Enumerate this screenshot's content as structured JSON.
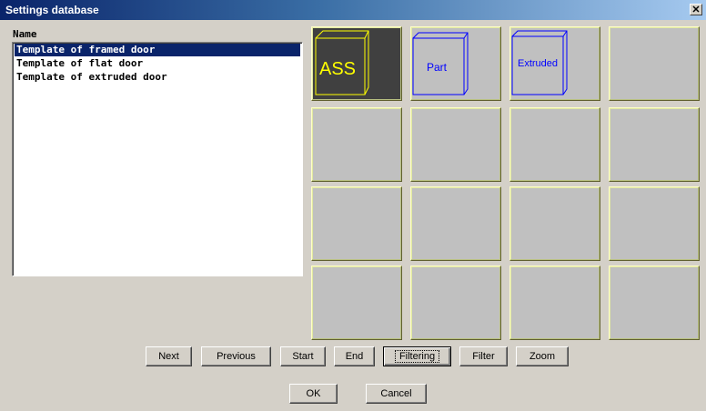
{
  "window": {
    "title": "Settings database",
    "close_glyph": "✕"
  },
  "list": {
    "header": "Name",
    "items": [
      {
        "label": "Template of framed door",
        "selected": true
      },
      {
        "label": "Template of flat door",
        "selected": false
      },
      {
        "label": "Template of extruded door",
        "selected": false
      }
    ]
  },
  "tiles": {
    "labels": [
      "ASS",
      "Part",
      "Extruded"
    ]
  },
  "nav_buttons": {
    "next": "Next",
    "previous": "Previous",
    "start": "Start",
    "end": "End",
    "filtering": "Filtering",
    "filter": "Filter",
    "zoom": "Zoom"
  },
  "dialog_buttons": {
    "ok": "OK",
    "cancel": "Cancel"
  },
  "colors": {
    "titlebar_start": "#0a246a",
    "tile_gray": "#c0c0c0",
    "selected_tile": "#404040",
    "ass_yellow": "#ffff00",
    "part_blue": "#0000ff"
  }
}
